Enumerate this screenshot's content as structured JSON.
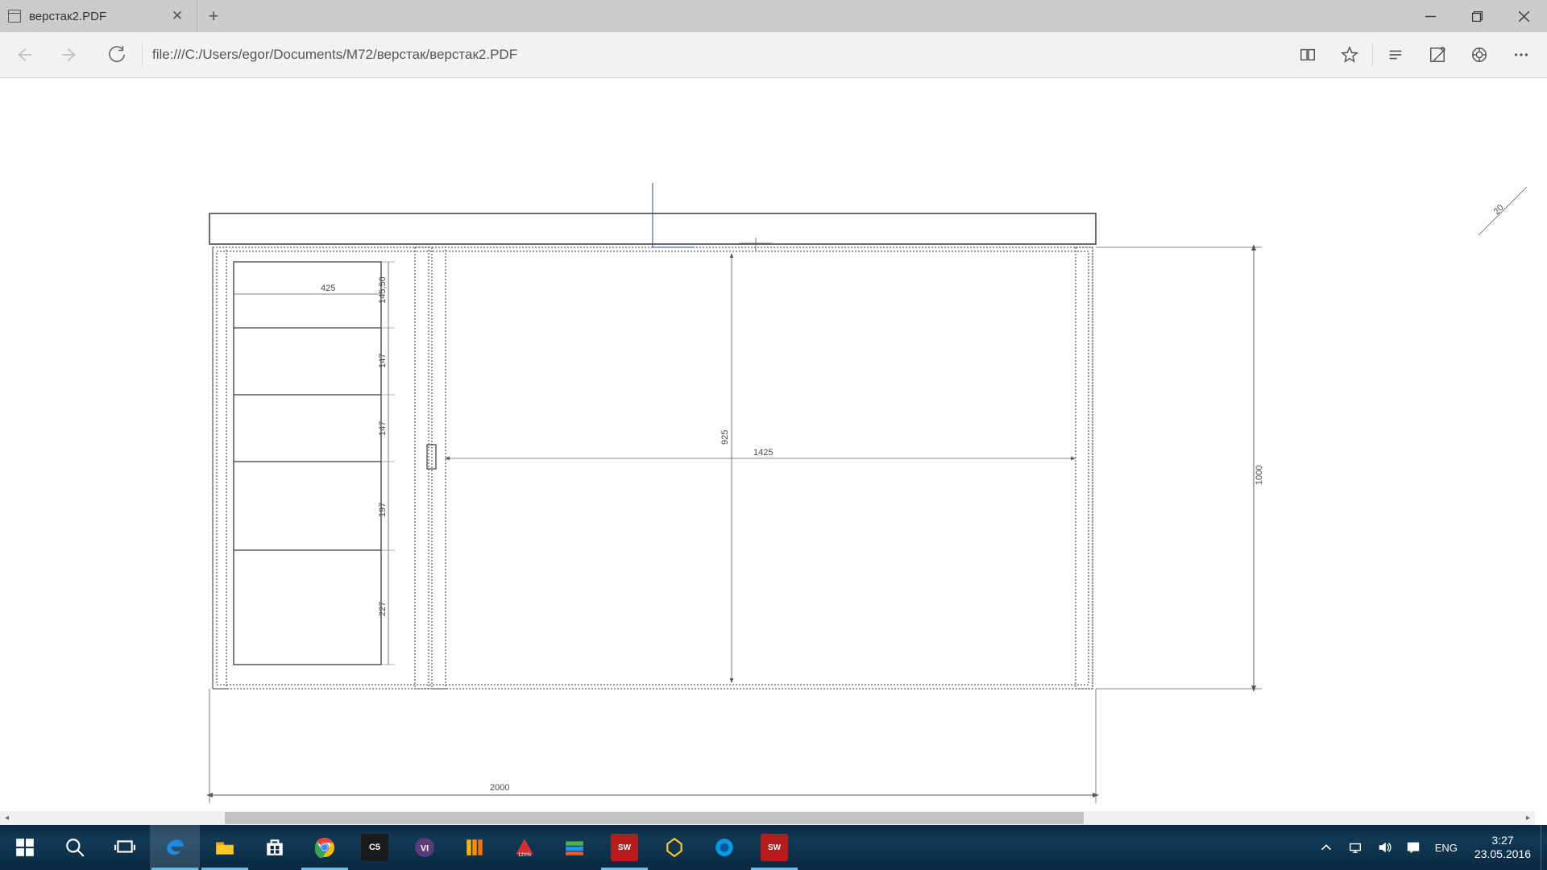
{
  "tab": {
    "title": "верстак2.PDF"
  },
  "url": "file:///C:/Users/egor/Documents/M72/верстак/верстак2.PDF",
  "tray": {
    "lang": "ENG",
    "time": "3:27",
    "date": "23.05.2016"
  },
  "drawing": {
    "dim_width_total": "2000",
    "dim_height_right": "1000",
    "dim_main_width": "1425",
    "dim_main_height": "925",
    "dim_shelf_width": "425",
    "shelf_heights": [
      "145,50",
      "147",
      "147",
      "197",
      "227"
    ],
    "corner_note": "20"
  },
  "scroll": {
    "thumb_left_pct": 14,
    "thumb_width_pct": 57
  }
}
